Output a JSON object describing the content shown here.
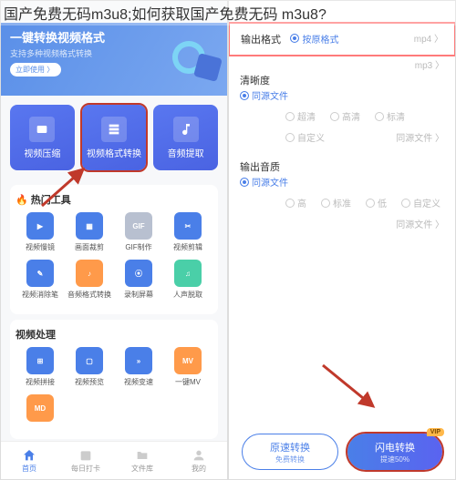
{
  "header_text": "国产免费无码m3u8;如何获取国产免费无码 m3u8?",
  "left": {
    "banner": {
      "title": "一键转换视频格式",
      "subtitle": "支持多种视频格式转换",
      "button": "立即使用 〉"
    },
    "main_cards": [
      {
        "label": "视频压缩",
        "icon": "compress"
      },
      {
        "label": "视频格式转换",
        "icon": "convert",
        "highlighted": true
      },
      {
        "label": "音频提取",
        "icon": "audio"
      }
    ],
    "hot_tools": {
      "title": "热门工具",
      "items": [
        {
          "label": "视频慢镜",
          "color": "blue",
          "glyph": "▶"
        },
        {
          "label": "画面裁剪",
          "color": "blue",
          "glyph": "▦"
        },
        {
          "label": "GIF制作",
          "color": "gray",
          "glyph": "GIF"
        },
        {
          "label": "视频剪辑",
          "color": "blue",
          "glyph": "✂"
        },
        {
          "label": "视频消除笔",
          "color": "blue",
          "glyph": "✎"
        },
        {
          "label": "音频格式转换",
          "color": "orange",
          "glyph": "♪"
        },
        {
          "label": "录制屏幕",
          "color": "blue",
          "glyph": "⦿"
        },
        {
          "label": "人声脱取",
          "color": "green",
          "glyph": "♫"
        }
      ]
    },
    "video_proc": {
      "title": "视频处理",
      "items": [
        {
          "label": "视频拼接",
          "color": "blue",
          "glyph": "⊞"
        },
        {
          "label": "视频预览",
          "color": "blue",
          "glyph": "▢"
        },
        {
          "label": "视频变速",
          "color": "blue",
          "glyph": "»"
        },
        {
          "label": "一键MV",
          "color": "orange",
          "glyph": "MV"
        },
        {
          "label": "",
          "color": "orange",
          "glyph": "MD"
        }
      ]
    },
    "nav": [
      {
        "label": "首页",
        "active": true
      },
      {
        "label": "每日打卡"
      },
      {
        "label": "文件库"
      },
      {
        "label": "我的"
      }
    ]
  },
  "right": {
    "output_format": {
      "label": "输出格式",
      "selected": "按原格式",
      "value": "mp4 〉"
    },
    "other_formats": [
      "mp3 〉"
    ],
    "clarity": {
      "label": "清晰度",
      "selected": "同源文件",
      "options": [
        "超清",
        "高清",
        "标清",
        "自定义"
      ],
      "value": "同源文件 〉"
    },
    "audio_quality": {
      "label": "输出音质",
      "selected": "同源文件",
      "options": [
        "高",
        "标准",
        "低",
        "自定义"
      ],
      "value": "同源文件 〉"
    },
    "buttons": {
      "normal": {
        "title": "原速转换",
        "sub": "免费转换"
      },
      "fast": {
        "title": "闪电转换",
        "sub": "提速50%",
        "vip": "VIP"
      }
    }
  }
}
